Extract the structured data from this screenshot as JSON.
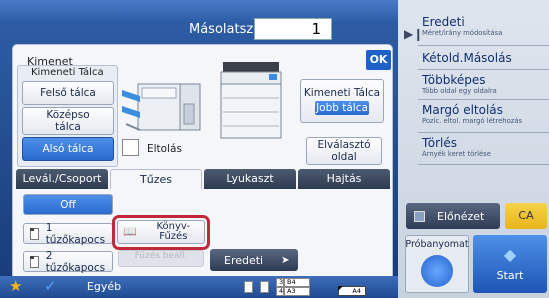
{
  "header": {
    "copies_label": "Másolatszám",
    "copies_value": "1"
  },
  "dialog": {
    "title": "Kimenet",
    "ok_label": "OK",
    "output_tray_label": "Kimeneti Tálca",
    "trays": [
      {
        "label": "Felső tálca",
        "selected": false
      },
      {
        "label": "Középso tálca",
        "selected": false
      },
      {
        "label": "Alsó tálca",
        "selected": true
      }
    ],
    "right_tray": {
      "title": "Kimeneti Tálca",
      "value": "Jobb tálca"
    },
    "offset_label": "Eltolás",
    "separator_label": "Elválasztó oldal",
    "tabs": [
      {
        "label": "Levál./Csoport",
        "active": false
      },
      {
        "label": "Tűzes",
        "active": true
      },
      {
        "label": "Lyukaszt",
        "active": false
      },
      {
        "label": "Hajtás",
        "active": false
      }
    ],
    "staple_options": [
      {
        "label": "Off",
        "selected": true
      },
      {
        "label": "1 tűzőkapocs",
        "selected": false
      },
      {
        "label": "2 tűzőkapocs",
        "selected": false
      }
    ],
    "book_label": "Könyv-Fűzés",
    "book_icon": "book-icon",
    "disabled_label": "Fűzés beáll.",
    "original_label": "Eredeti"
  },
  "right_panel": {
    "items": [
      {
        "title": "Eredeti",
        "sub": "Méret/irány módosítása"
      },
      {
        "title": "Kétold.Másolás",
        "sub": ""
      },
      {
        "title": "Többképes",
        "sub": "Több oldal egy oldalra"
      },
      {
        "title": "Margó eltolás",
        "sub": "Pozíc. eltol. margó létrehozás"
      },
      {
        "title": "Törlés",
        "sub": "Árnyék keret törlése"
      }
    ],
    "preview_label": "Előnézet",
    "ca_label": "CA",
    "proof_label": "Próbanyomat",
    "start_label": "Start"
  },
  "bottom": {
    "other_label": "Egyéb",
    "paper_rows": [
      {
        "num": "3",
        "size": "B4"
      },
      {
        "num": "4",
        "size": "A3"
      }
    ],
    "current_paper": "A4"
  },
  "colors": {
    "accent_blue": "#2a6ad0",
    "highlight_red": "#c1283a",
    "ca_yellow": "#e8b41c"
  }
}
